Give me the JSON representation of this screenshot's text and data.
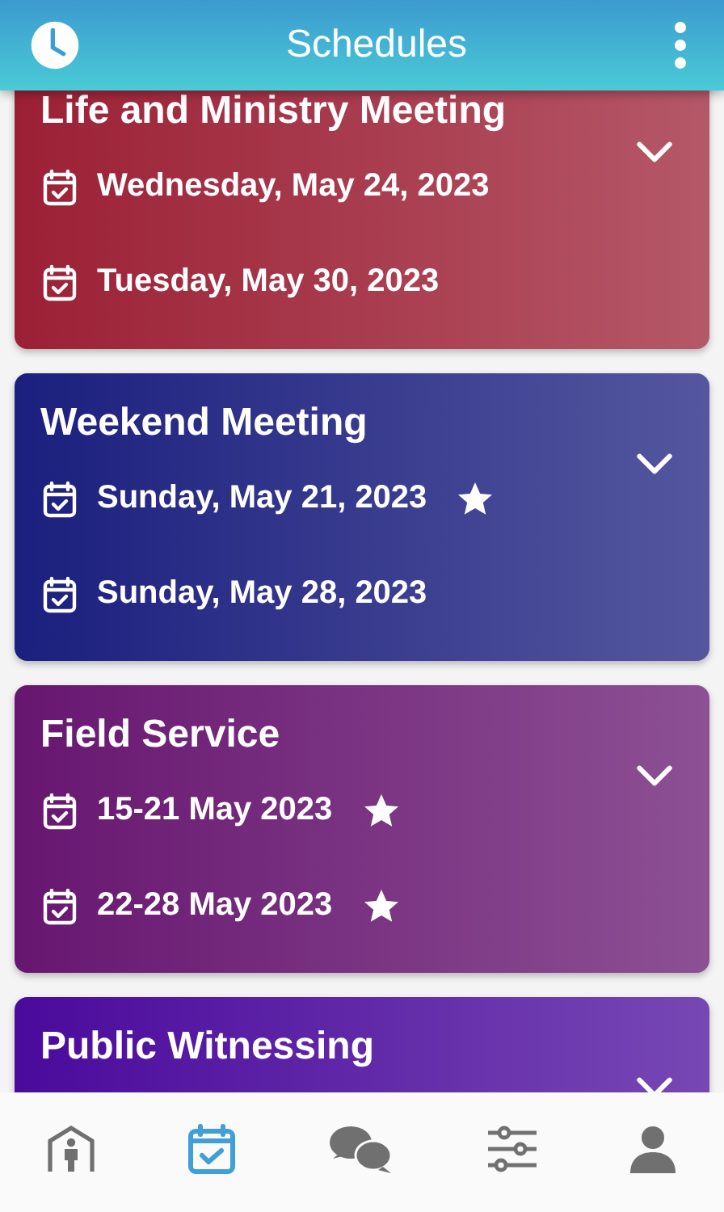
{
  "header": {
    "title": "Schedules"
  },
  "cards": [
    {
      "title": "Life and Ministry Meeting",
      "color": "#9c2035",
      "expanded": false,
      "dates": [
        {
          "text": "Wednesday, May 24, 2023",
          "starred": false
        },
        {
          "text": "Tuesday, May 30, 2023",
          "starred": false
        }
      ]
    },
    {
      "title": "Weekend Meeting",
      "color": "#1b1f7e",
      "expanded": false,
      "dates": [
        {
          "text": "Sunday, May 21, 2023",
          "starred": true
        },
        {
          "text": "Sunday, May 28, 2023",
          "starred": false
        }
      ]
    },
    {
      "title": "Field Service",
      "color": "#671670",
      "expanded": false,
      "dates": [
        {
          "text": "15-21 May 2023",
          "starred": true
        },
        {
          "text": "22-28 May 2023",
          "starred": true
        }
      ]
    },
    {
      "title": "Public Witnessing",
      "color": "#4a0a9c",
      "expanded": false
    }
  ],
  "nav": [
    {
      "kind": "home",
      "selected": false
    },
    {
      "kind": "calendar",
      "selected": true
    },
    {
      "kind": "chat",
      "selected": false
    },
    {
      "kind": "sliders",
      "selected": false
    },
    {
      "kind": "person",
      "selected": false
    }
  ]
}
